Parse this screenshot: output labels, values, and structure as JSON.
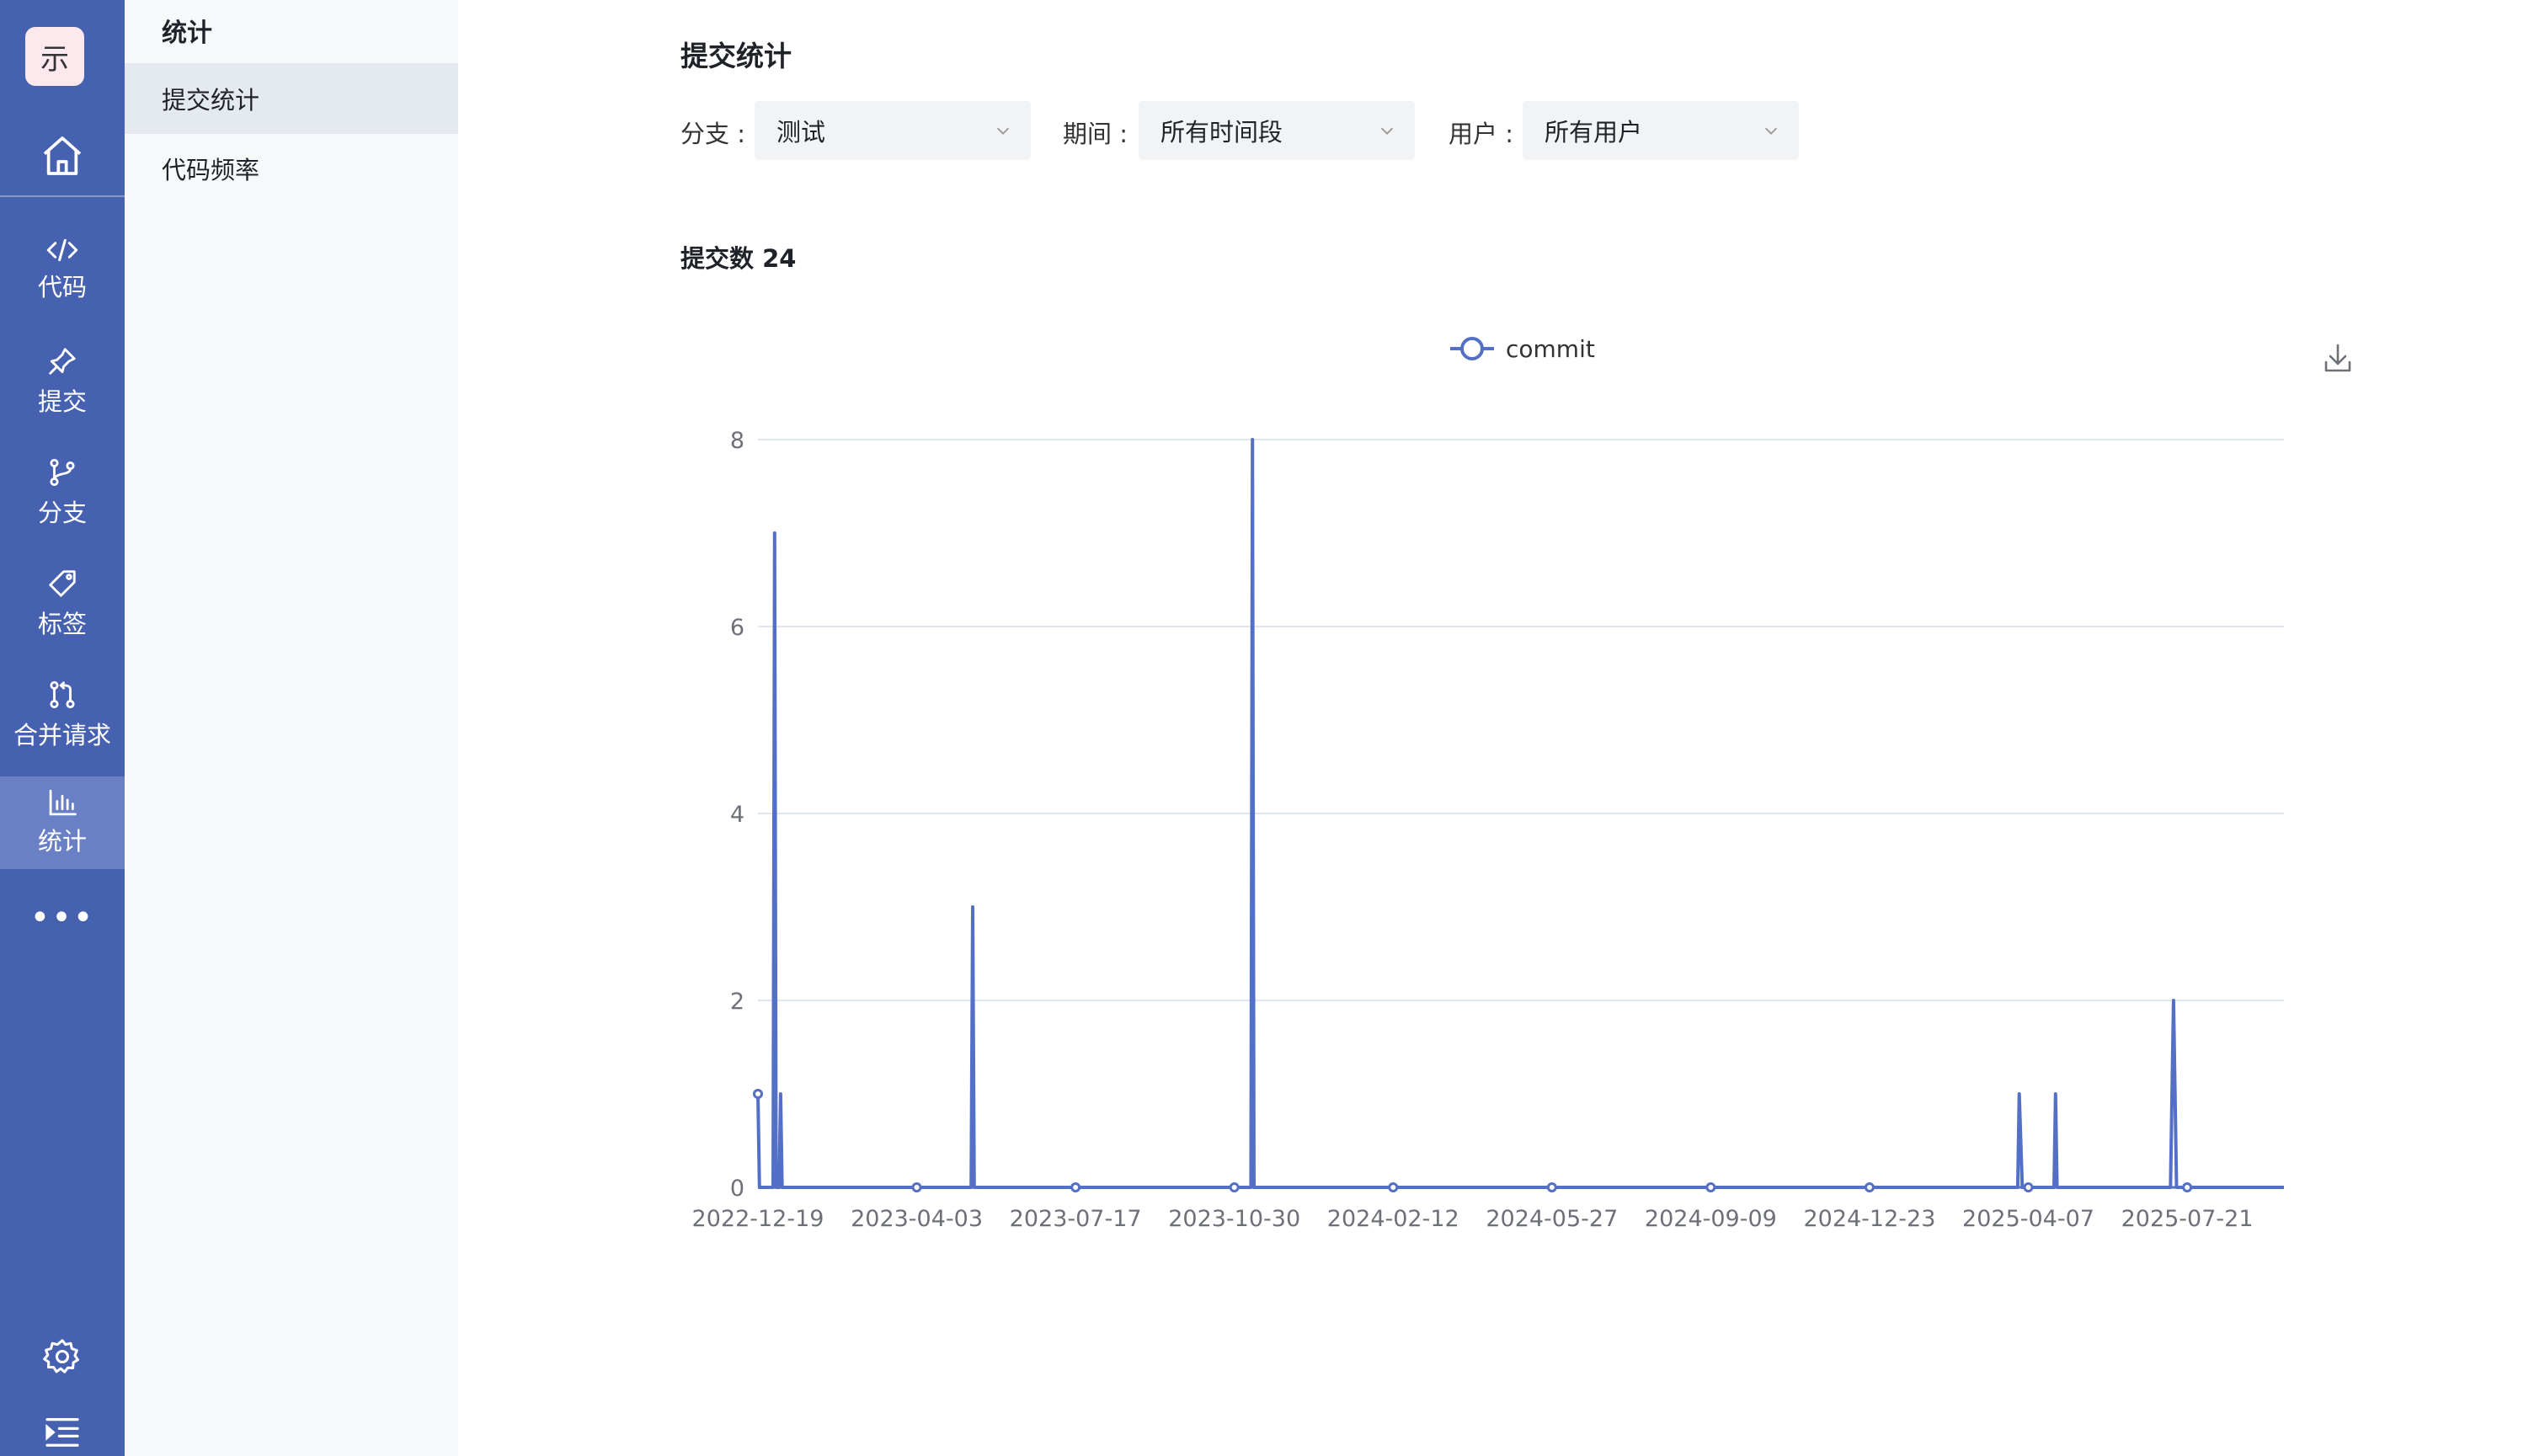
{
  "rail": {
    "logo": "示",
    "items": [
      {
        "label": "代码",
        "icon": "code-icon"
      },
      {
        "label": "提交",
        "icon": "pin-icon"
      },
      {
        "label": "分支",
        "icon": "branch-icon"
      },
      {
        "label": "标签",
        "icon": "tag-icon"
      },
      {
        "label": "合并请求",
        "icon": "merge-request-icon"
      },
      {
        "label": "统计",
        "icon": "bar-chart-icon",
        "active": true
      }
    ],
    "more": "•••",
    "colors": {
      "background": "#4561af",
      "active": "#6a80c4"
    }
  },
  "submenu": {
    "title": "统计",
    "items": [
      {
        "label": "提交统计",
        "active": true
      },
      {
        "label": "代码频率"
      }
    ]
  },
  "main": {
    "title": "提交统计",
    "filters": {
      "branch": {
        "label": "分支 :",
        "value": "测试"
      },
      "period": {
        "label": "期间 :",
        "value": "所有时间段"
      },
      "user": {
        "label": "用户 :",
        "value": "所有用户"
      }
    },
    "commit_count": "提交数 24"
  },
  "chart_data": {
    "type": "line",
    "title": "",
    "xlabel": "",
    "ylabel": "",
    "legend": {
      "entries": [
        "commit"
      ],
      "position": "top-center"
    },
    "color": "#5470c6",
    "ylim": [
      0,
      8
    ],
    "yticks": [
      0,
      2,
      4,
      6,
      8
    ],
    "xlim": [
      "2022-12-19",
      "2025-09-23"
    ],
    "xticks": [
      "2022-12-19",
      "2023-04-03",
      "2023-07-17",
      "2023-10-30",
      "2024-02-12",
      "2024-05-27",
      "2024-09-09",
      "2024-12-23",
      "2025-04-07",
      "2025-07-21"
    ],
    "grid": true,
    "series": [
      {
        "name": "commit",
        "points": [
          {
            "x": "2022-12-19",
            "y": 1
          },
          {
            "x": "2022-12-20",
            "y": 0
          },
          {
            "x": "2022-12-29",
            "y": 0
          },
          {
            "x": "2022-12-30",
            "y": 7
          },
          {
            "x": "2022-12-31",
            "y": 0
          },
          {
            "x": "2023-01-02",
            "y": 0
          },
          {
            "x": "2023-01-03",
            "y": 1
          },
          {
            "x": "2023-01-04",
            "y": 0
          },
          {
            "x": "2023-05-09",
            "y": 0
          },
          {
            "x": "2023-05-10",
            "y": 3
          },
          {
            "x": "2023-05-11",
            "y": 0
          },
          {
            "x": "2023-11-10",
            "y": 0
          },
          {
            "x": "2023-11-11",
            "y": 8
          },
          {
            "x": "2023-11-12",
            "y": 0
          },
          {
            "x": "2025-03-31",
            "y": 0
          },
          {
            "x": "2025-04-01",
            "y": 1
          },
          {
            "x": "2025-04-03",
            "y": 0
          },
          {
            "x": "2025-04-24",
            "y": 0
          },
          {
            "x": "2025-04-25",
            "y": 1
          },
          {
            "x": "2025-04-26",
            "y": 0
          },
          {
            "x": "2025-07-10",
            "y": 0
          },
          {
            "x": "2025-07-12",
            "y": 2
          },
          {
            "x": "2025-07-14",
            "y": 0
          },
          {
            "x": "2025-09-23",
            "y": 0
          }
        ]
      }
    ]
  }
}
